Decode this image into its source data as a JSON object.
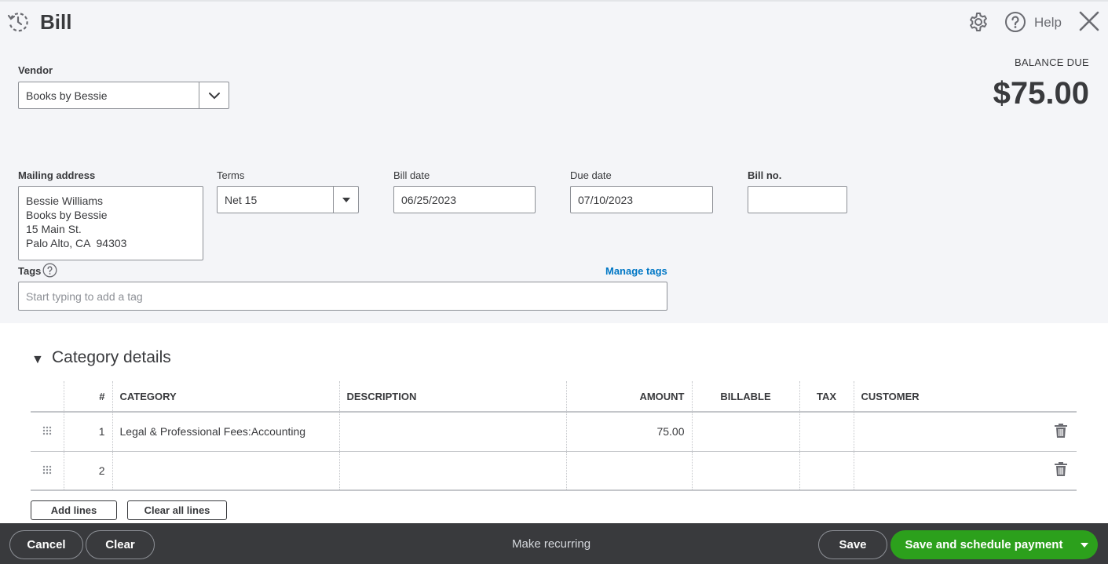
{
  "header": {
    "title": "Bill",
    "help_label": "Help",
    "icons": {
      "history": "history-clock-icon",
      "settings": "gear-icon",
      "help": "help-circle-icon",
      "close": "close-icon"
    }
  },
  "vendor": {
    "label": "Vendor",
    "value": "Books by Bessie"
  },
  "balance": {
    "label": "BALANCE DUE",
    "amount": "$75.00"
  },
  "mailing_address": {
    "label": "Mailing address",
    "lines": [
      "Bessie Williams",
      "Books by Bessie",
      "15 Main St.",
      "Palo Alto, CA  94303"
    ]
  },
  "terms": {
    "label": "Terms",
    "value": "Net 15"
  },
  "bill_date": {
    "label": "Bill date",
    "value": "06/25/2023"
  },
  "due_date": {
    "label": "Due date",
    "value": "07/10/2023"
  },
  "bill_no": {
    "label": "Bill no.",
    "value": ""
  },
  "tags": {
    "label": "Tags",
    "manage_label": "Manage tags",
    "placeholder": "Start typing to add a tag"
  },
  "category_details": {
    "title": "Category details",
    "columns": [
      "#",
      "CATEGORY",
      "DESCRIPTION",
      "AMOUNT",
      "BILLABLE",
      "TAX",
      "CUSTOMER"
    ],
    "rows": [
      {
        "num": "1",
        "category": "Legal & Professional Fees:Accounting",
        "description": "",
        "amount": "75.00",
        "billable": "",
        "tax": "",
        "customer": ""
      },
      {
        "num": "2",
        "category": "",
        "description": "",
        "amount": "",
        "billable": "",
        "tax": "",
        "customer": ""
      }
    ],
    "add_lines_label": "Add lines",
    "clear_lines_label": "Clear all lines"
  },
  "footer": {
    "cancel_label": "Cancel",
    "clear_label": "Clear",
    "recurring_label": "Make recurring",
    "save_label": "Save",
    "primary_label": "Save and schedule payment"
  },
  "colors": {
    "accent_green": "#2ca01c",
    "link_blue": "#0077c5",
    "footer_bg": "#393a3d",
    "form_bg": "#f4f5f8"
  }
}
